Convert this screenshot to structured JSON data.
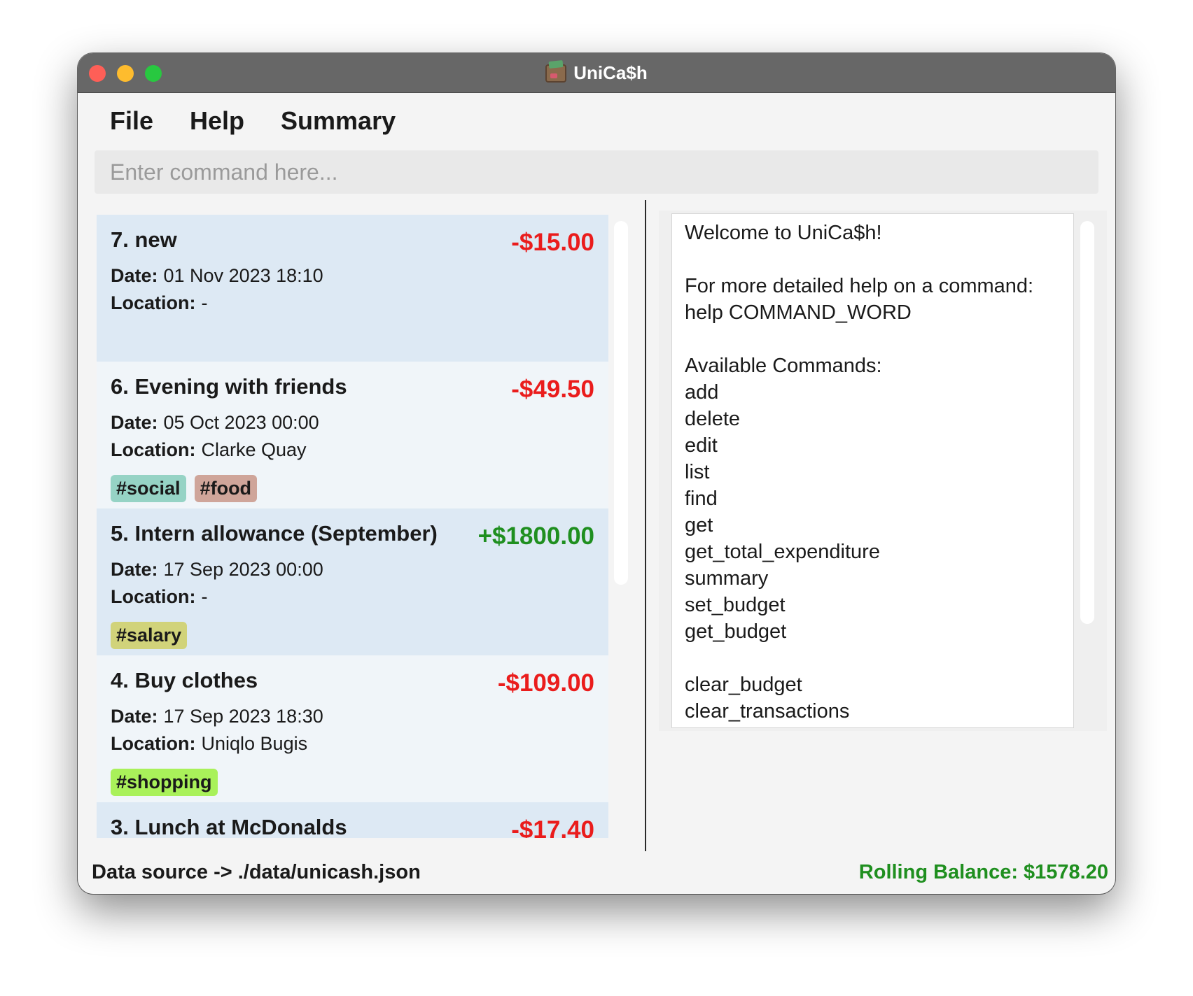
{
  "window": {
    "title": "UniCa$h"
  },
  "menu": {
    "file": "File",
    "help": "Help",
    "summary": "Summary"
  },
  "command": {
    "placeholder": "Enter command here..."
  },
  "labels": {
    "date": "Date:",
    "location": "Location:"
  },
  "transactions": [
    {
      "title": "7. new",
      "amount": "-$15.00",
      "amount_type": "expense",
      "date": "01 Nov 2023 18:10",
      "location": "-",
      "tags": []
    },
    {
      "title": "6. Evening with friends",
      "amount": "-$49.50",
      "amount_type": "expense",
      "date": "05 Oct 2023 00:00",
      "location": "Clarke Quay",
      "tags": [
        {
          "label": "#social",
          "color": "#96d3c5"
        },
        {
          "label": "#food",
          "color": "#cfa59a"
        }
      ]
    },
    {
      "title": "5. Intern allowance (September)",
      "amount": "+$1800.00",
      "amount_type": "income",
      "date": "17 Sep 2023 00:00",
      "location": "-",
      "tags": [
        {
          "label": "#salary",
          "color": "#d1d37a"
        }
      ]
    },
    {
      "title": "4. Buy clothes",
      "amount": "-$109.00",
      "amount_type": "expense",
      "date": "17 Sep 2023 18:30",
      "location": "Uniqlo Bugis",
      "tags": [
        {
          "label": "#shopping",
          "color": "#a9f15a"
        }
      ]
    },
    {
      "title": "3. Lunch at McDonalds",
      "amount": "-$17.40",
      "amount_type": "expense",
      "date": "",
      "location": "",
      "tags": []
    }
  ],
  "help_text": "Welcome to UniCa$h!\n\nFor more detailed help on a command:\nhelp COMMAND_WORD\n\nAvailable Commands:\nadd\ndelete\nedit\nlist\nfind\nget\nget_total_expenditure\nsummary\nset_budget\nget_budget\n\nclear_budget\nclear_transactions",
  "status": {
    "data_source": "Data source -> ./data/unicash.json",
    "rolling_balance": "Rolling Balance: $1578.20"
  },
  "colors": {
    "expense": "#ea1c1c",
    "income": "#1f8f1f",
    "card_shade": "#dde9f4",
    "card_plain": "#f0f5f9"
  }
}
